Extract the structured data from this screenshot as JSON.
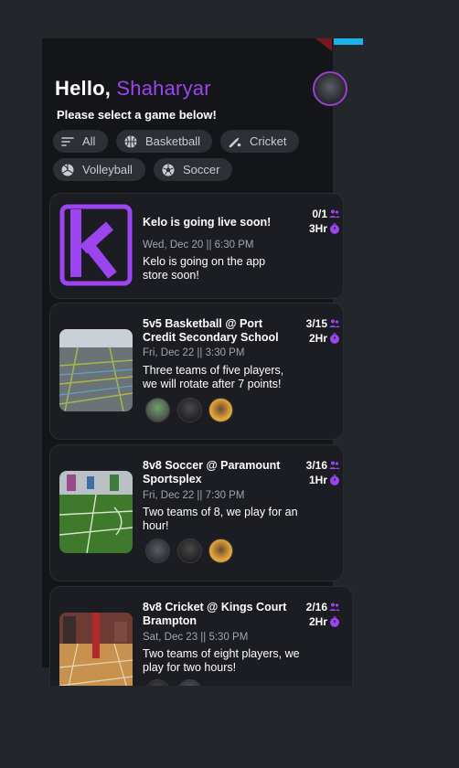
{
  "header": {
    "greeting": "Hello,",
    "user_name": "Shaharyar",
    "subtitle": "Please select a game below!"
  },
  "filters": [
    {
      "label": "All",
      "icon": "filter-lines-icon"
    },
    {
      "label": "Basketball",
      "icon": "basketball-icon"
    },
    {
      "label": "Cricket",
      "icon": "cricket-icon"
    },
    {
      "label": "Volleyball",
      "icon": "volleyball-icon"
    },
    {
      "label": "Soccer",
      "icon": "soccer-ball-icon"
    }
  ],
  "games": [
    {
      "title": "Kelo is going live soon!",
      "date": "Wed, Dec 20 || 6:30 PM",
      "description": "Kelo is going on the app store soon!",
      "players": "0/1",
      "duration": "3Hr"
    },
    {
      "title": "5v5 Basketball @ Port Credit Secondary School",
      "date": "Fri, Dec 22 || 3:30 PM",
      "description": "Three teams of five players, we will rotate after 7 points!",
      "players": "3/15",
      "duration": "2Hr"
    },
    {
      "title": "8v8 Soccer @ Paramount Sportsplex",
      "date": "Fri, Dec 22 || 7:30 PM",
      "description": "Two teams of 8, we play for an hour!",
      "players": "3/16",
      "duration": "1Hr"
    },
    {
      "title": "8v8 Cricket @ Kings Court Brampton",
      "date": "Sat, Dec 23 || 5:30 PM",
      "description": "Two teams of eight players, we play for two hours!",
      "players": "2/16",
      "duration": "2Hr"
    }
  ],
  "colors": {
    "accent": "#9b44f0",
    "background": "#141518",
    "card": "#1c1d22",
    "chip": "#2c2f35"
  }
}
